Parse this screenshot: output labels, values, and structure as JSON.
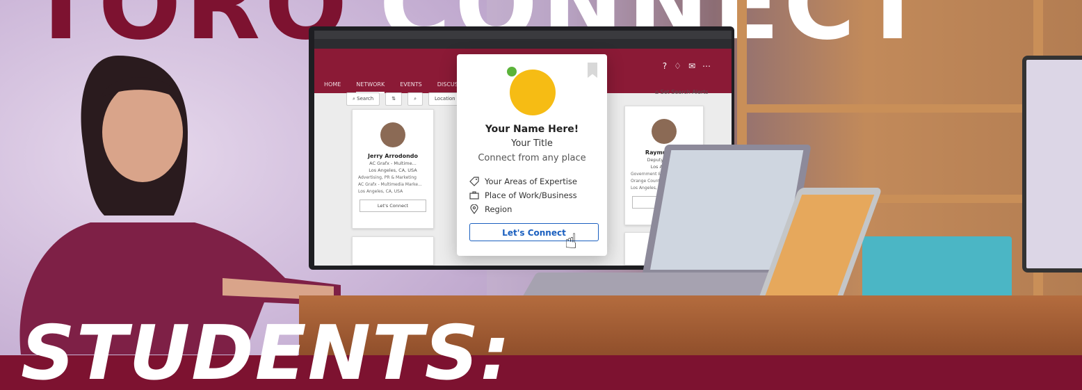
{
  "headline": {
    "word1": "TORO",
    "word2": "CONNECT"
  },
  "footer_text": "STUDENTS:",
  "app": {
    "nav": [
      "HOME",
      "NETWORK",
      "EVENTS",
      "DISCUSSION"
    ],
    "active_nav": "NETWORK",
    "filters": {
      "search": "Search",
      "location": "Location"
    },
    "set_search_alerts": "Set Search Alerts",
    "cards": [
      {
        "name": "Jerry Arrodondo",
        "title": "AC Grafx - Multime...",
        "location": "Los Angeles, CA, USA",
        "tags": [
          "Advertising, PR & Marketing",
          "AC Grafx - Multimedia Marke...",
          "Los Angeles, CA, USA"
        ],
        "button": "Let's Connect"
      },
      {
        "name": "Raymund Di",
        "title": "Deputy District",
        "location": "Los Angeles",
        "tags": [
          "Government & P",
          "Orange County",
          "Los Angeles, C"
        ],
        "button": "Let's C"
      }
    ]
  },
  "popup": {
    "name": "Your Name Here!",
    "title": "Your Title",
    "tagline": "Connect from any place",
    "expertise": "Your Areas of Expertise",
    "workplace": "Place of Work/Business",
    "region": "Region",
    "button": "Let's Connect",
    "colors": {
      "avatar": "#f6bc14",
      "status_dot": "#5bb33a",
      "button": "#1a5fbf"
    }
  },
  "colors": {
    "maroon": "#7d1230",
    "app_header": "#8b1a36"
  }
}
